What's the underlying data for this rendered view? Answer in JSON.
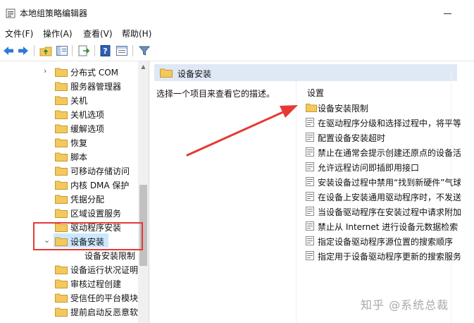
{
  "window": {
    "title": "本地组策略编辑器"
  },
  "menu": [
    {
      "label": "文件(F)"
    },
    {
      "label": "操作(A)"
    },
    {
      "label": "查看(V)"
    },
    {
      "label": "帮助(H)"
    }
  ],
  "toolbar": {
    "icons": [
      "back-arrow-icon",
      "forward-arrow-icon",
      "up-folder-icon",
      "show-hide-tree-icon",
      "export-list-icon",
      "help-icon",
      "properties-icon",
      "filter-icon"
    ]
  },
  "tree": {
    "items": [
      {
        "label": "分布式 COM",
        "expander": "›"
      },
      {
        "label": "服务器管理器",
        "expander": ""
      },
      {
        "label": "关机",
        "expander": ""
      },
      {
        "label": "关机选项",
        "expander": ""
      },
      {
        "label": "缓解选项",
        "expander": ""
      },
      {
        "label": "恢复",
        "expander": ""
      },
      {
        "label": "脚本",
        "expander": ""
      },
      {
        "label": "可移动存储访问",
        "expander": ""
      },
      {
        "label": "内核 DMA 保护",
        "expander": ""
      },
      {
        "label": "凭据分配",
        "expander": ""
      },
      {
        "label": "区域设置服务",
        "expander": ""
      },
      {
        "label": "驱动程序安装",
        "expander": ""
      },
      {
        "label": "设备安装",
        "expander": "⌄"
      },
      {
        "label": "设备安装限制",
        "expander": ""
      },
      {
        "label": "设备运行状况证明",
        "expander": ""
      },
      {
        "label": "审核过程创建",
        "expander": ""
      },
      {
        "label": "受信任的平台模块",
        "expander": ""
      },
      {
        "label": "提前启动反恶意软",
        "expander": ""
      }
    ],
    "selected_index": 12
  },
  "details": {
    "header": "设备安装",
    "description": "选择一个项目来查看它的描述。",
    "column_header": "设置",
    "settings": [
      {
        "label": "设备安装限制",
        "icon": "folder-icon"
      },
      {
        "label": "在驱动程序分级和选择过程中，将平等",
        "icon": "policy-setting-icon"
      },
      {
        "label": "配置设备安装超时",
        "icon": "policy-setting-icon"
      },
      {
        "label": "禁止在通常会提示创建还原点的设备活",
        "icon": "policy-setting-icon"
      },
      {
        "label": "允许远程访问即插即用接口",
        "icon": "policy-setting-icon"
      },
      {
        "label": "安装设备过程中禁用“找到新硬件”气球",
        "icon": "policy-setting-icon"
      },
      {
        "label": "在设备上安装通用驱动程序时，不发送",
        "icon": "policy-setting-icon"
      },
      {
        "label": "当设备驱动程序在安装过程中请求附加",
        "icon": "policy-setting-icon"
      },
      {
        "label": "禁止从 Internet 进行设备元数据检索",
        "icon": "policy-setting-icon"
      },
      {
        "label": "指定设备驱动程序源位置的搜索顺序",
        "icon": "policy-setting-icon"
      },
      {
        "label": "指定用于设备驱动程序更新的搜索服务",
        "icon": "policy-setting-icon"
      }
    ]
  },
  "watermark": "知乎 @系统总裁",
  "colors": {
    "annotation_red": "#e53935",
    "folder_yellow": "#f3c95d",
    "selection_blue": "#cce8ff",
    "header_blue": "#dfe9f5"
  }
}
